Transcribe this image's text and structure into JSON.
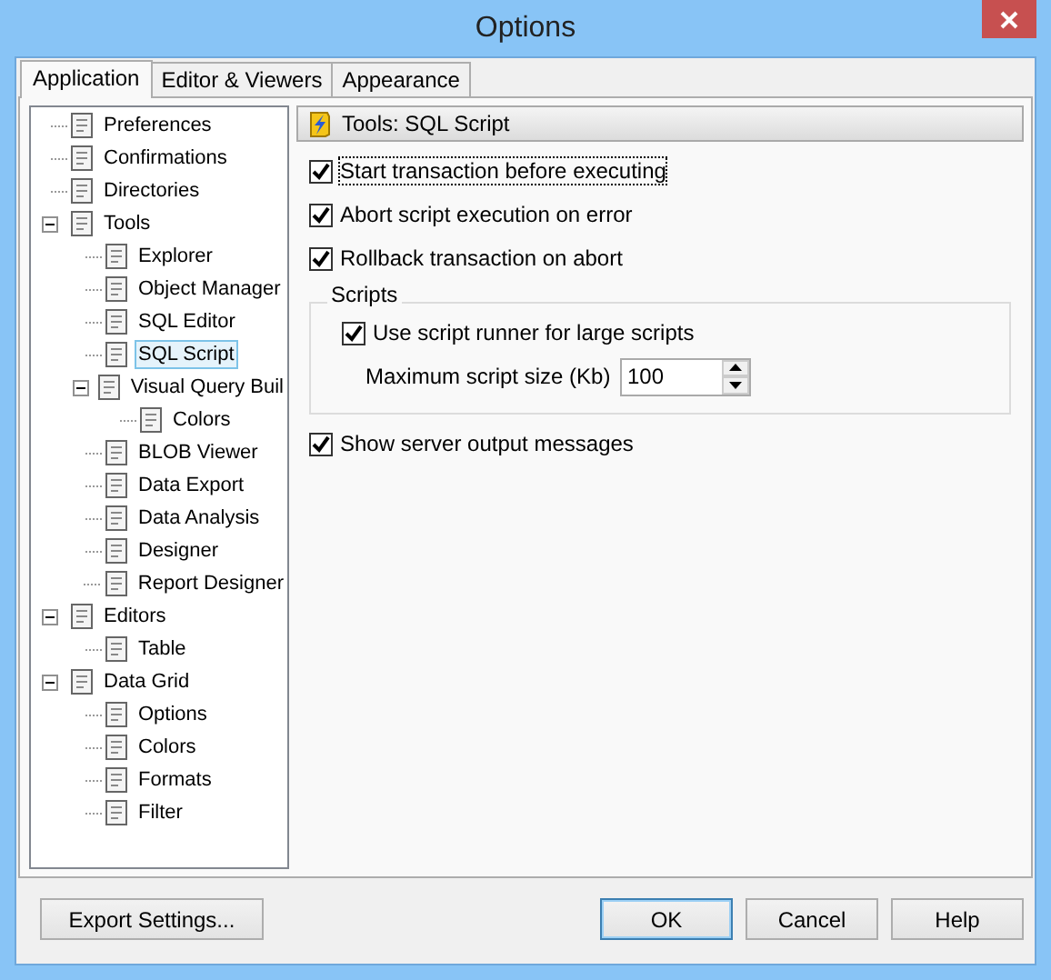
{
  "window": {
    "title": "Options"
  },
  "tabs": [
    {
      "label": "Application",
      "selected": true
    },
    {
      "label": "Editor & Viewers",
      "selected": false
    },
    {
      "label": "Appearance",
      "selected": false
    }
  ],
  "tree": [
    {
      "label": "Preferences",
      "selected": false
    },
    {
      "label": "Confirmations",
      "selected": false
    },
    {
      "label": "Directories",
      "selected": false
    },
    {
      "label": "Tools",
      "selected": false,
      "expanded": true,
      "children": [
        {
          "label": "Explorer",
          "selected": false
        },
        {
          "label": "Object Manager",
          "selected": false
        },
        {
          "label": "SQL Editor",
          "selected": false
        },
        {
          "label": "SQL Script",
          "selected": true
        },
        {
          "label": "Visual Query Buil",
          "selected": false,
          "expanded": true,
          "children": [
            {
              "label": "Colors",
              "selected": false
            }
          ]
        },
        {
          "label": "BLOB Viewer",
          "selected": false
        },
        {
          "label": "Data Export",
          "selected": false
        },
        {
          "label": "Data Analysis",
          "selected": false
        },
        {
          "label": "Designer",
          "selected": false
        },
        {
          "label": "Report Designer",
          "selected": false
        }
      ]
    },
    {
      "label": "Editors",
      "selected": false,
      "expanded": true,
      "children": [
        {
          "label": "Table",
          "selected": false
        }
      ]
    },
    {
      "label": "Data Grid",
      "selected": false,
      "expanded": true,
      "children": [
        {
          "label": "Options",
          "selected": false
        },
        {
          "label": "Colors",
          "selected": false
        },
        {
          "label": "Formats",
          "selected": false
        },
        {
          "label": "Filter",
          "selected": false
        }
      ]
    }
  ],
  "panel": {
    "title": "Tools: SQL Script"
  },
  "options": [
    {
      "kind": "checkbox",
      "label": "Start transaction before executing",
      "checked": true,
      "focused": true
    },
    {
      "kind": "checkbox",
      "label": "Abort script execution on error",
      "checked": true,
      "focused": false
    },
    {
      "kind": "checkbox",
      "label": "Rollback transaction on abort",
      "checked": true,
      "focused": false
    },
    {
      "kind": "group",
      "title": "Scripts",
      "items": [
        {
          "kind": "checkbox",
          "label": "Use script runner for large scripts",
          "checked": true,
          "focused": false
        },
        {
          "kind": "spin",
          "label": "Maximum script size (Kb)",
          "value": "100"
        }
      ]
    },
    {
      "kind": "checkbox",
      "label": "Show server output messages",
      "checked": true,
      "focused": false
    }
  ],
  "buttons": [
    {
      "label": "Export Settings...",
      "default": false
    },
    {
      "label": "OK",
      "default": true
    },
    {
      "label": "Cancel",
      "default": false
    },
    {
      "label": "Help",
      "default": false
    }
  ]
}
